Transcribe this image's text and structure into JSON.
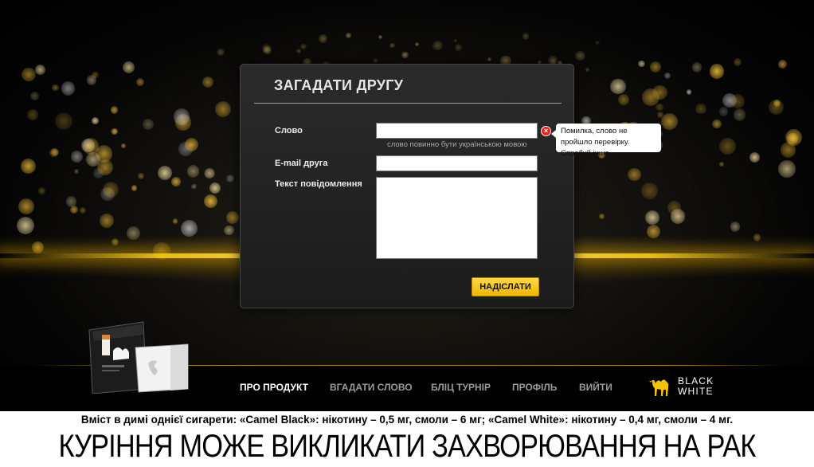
{
  "form": {
    "title": "ЗАГАДАТИ ДРУГУ",
    "word_label": "Слово",
    "word_value": "",
    "word_hint": "слово повинно бути українською мовою",
    "error_tooltip": "Помилка, слово не пройшло перевірку. Спробуй інше.",
    "email_label": "E-mail друга",
    "email_value": "",
    "message_label": "Текст повідомлення",
    "message_value": "",
    "submit_label": "НАДІСЛАТИ",
    "accent_color": "#f0b400"
  },
  "nav": {
    "items": [
      {
        "label": "ПРО ПРОДУКТ",
        "active": true
      },
      {
        "label": "ВГАДАТИ СЛОВО",
        "active": false
      },
      {
        "label": "БЛІЦ ТУРНІР",
        "active": false
      },
      {
        "label": "ПРОФІЛЬ",
        "active": false
      },
      {
        "label": "ВИЙТИ",
        "active": false
      }
    ]
  },
  "brand": {
    "line1": "BLACK",
    "line2": "WHITE",
    "icon": "camel-icon",
    "color": "#f5c400"
  },
  "warning": {
    "small": "Вміст в димі однієї сигарети: «Camel Black»: нікотину – 0,5 мг, смоли – 6 мг; «Camel White»: нікотину – 0,4 мг, смоли – 4 мг.",
    "big": "КУРІННЯ МОЖЕ ВИКЛИКАТИ ЗАХВОРЮВАННЯ НА РАК"
  }
}
